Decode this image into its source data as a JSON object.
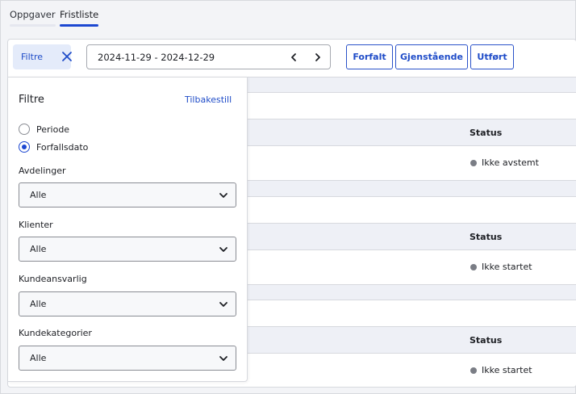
{
  "tabs": [
    {
      "label": "Oppgaver"
    },
    {
      "label": "Fristliste"
    }
  ],
  "toolbar": {
    "filter_label": "Filtre",
    "date_range": "2024-11-29 - 2024-12-29",
    "buttons": [
      "Forfalt",
      "Gjenstående",
      "Utført"
    ]
  },
  "table": {
    "status_header": "Status",
    "rows": [
      {
        "status": "Ikke avstemt"
      },
      {
        "status": "Ikke startet"
      },
      {
        "status": "Ikke startet"
      }
    ]
  },
  "filter_panel": {
    "title": "Filtre",
    "reset_label": "Tilbakestill",
    "radio_options": [
      {
        "label": "Periode",
        "selected": false
      },
      {
        "label": "Forfallsdato",
        "selected": true
      }
    ],
    "fields": [
      {
        "label": "Avdelinger",
        "value": "Alle"
      },
      {
        "label": "Klienter",
        "value": "Alle"
      },
      {
        "label": "Kundeansvarlig",
        "value": "Alle"
      },
      {
        "label": "Kundekategorier",
        "value": "Alle"
      }
    ]
  },
  "colors": {
    "accent": "#1c47d1",
    "status_dot": "#7a7d85",
    "header_bg": "#eef0f6"
  }
}
